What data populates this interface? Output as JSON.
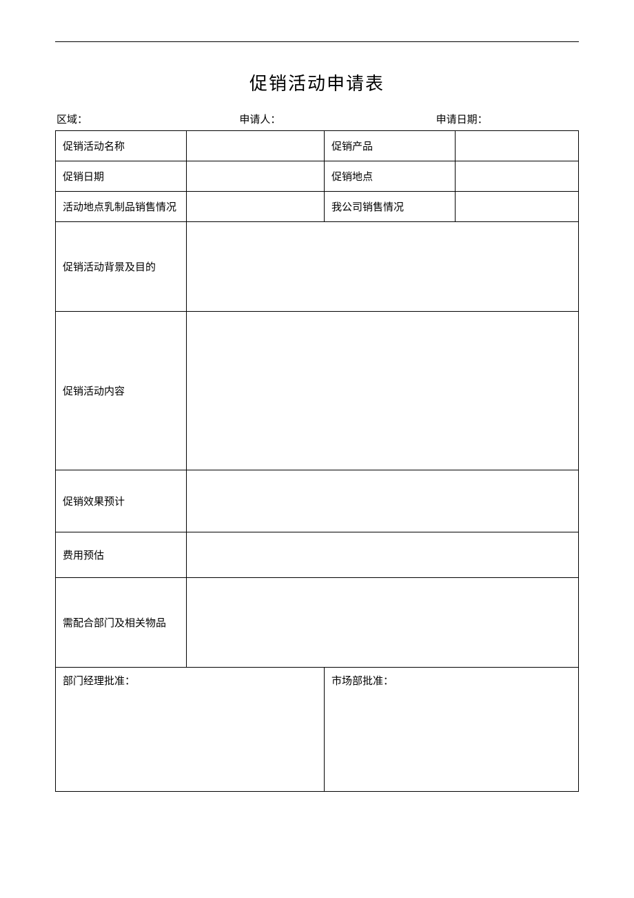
{
  "title": "促销活动申请表",
  "header": {
    "region_label": "区域：",
    "region_value": "",
    "applicant_label": "申请人：",
    "applicant_value": "",
    "apply_date_label": "申请日期：",
    "apply_date_value": ""
  },
  "rows": {
    "activity_name_label": "促销活动名称",
    "activity_name_value": "",
    "product_label": "促销产品",
    "product_value": "",
    "date_label": "促销日期",
    "date_value": "",
    "location_label": "促销地点",
    "location_value": "",
    "dairy_sales_label": "活动地点乳制品销售情况",
    "dairy_sales_value": "",
    "company_sales_label": "我公司销售情况",
    "company_sales_value": "",
    "background_label": "促销活动背景及目的",
    "background_value": "",
    "content_label": "促销活动内容",
    "content_value": "",
    "effect_label": "促销效果预计",
    "effect_value": "",
    "cost_label": "费用预估",
    "cost_value": "",
    "coop_label": "需配合部门及相关物品",
    "coop_value": "",
    "dept_approve_label": "部门经理批准：",
    "dept_approve_value": "",
    "market_approve_label": "市场部批准：",
    "market_approve_value": ""
  }
}
